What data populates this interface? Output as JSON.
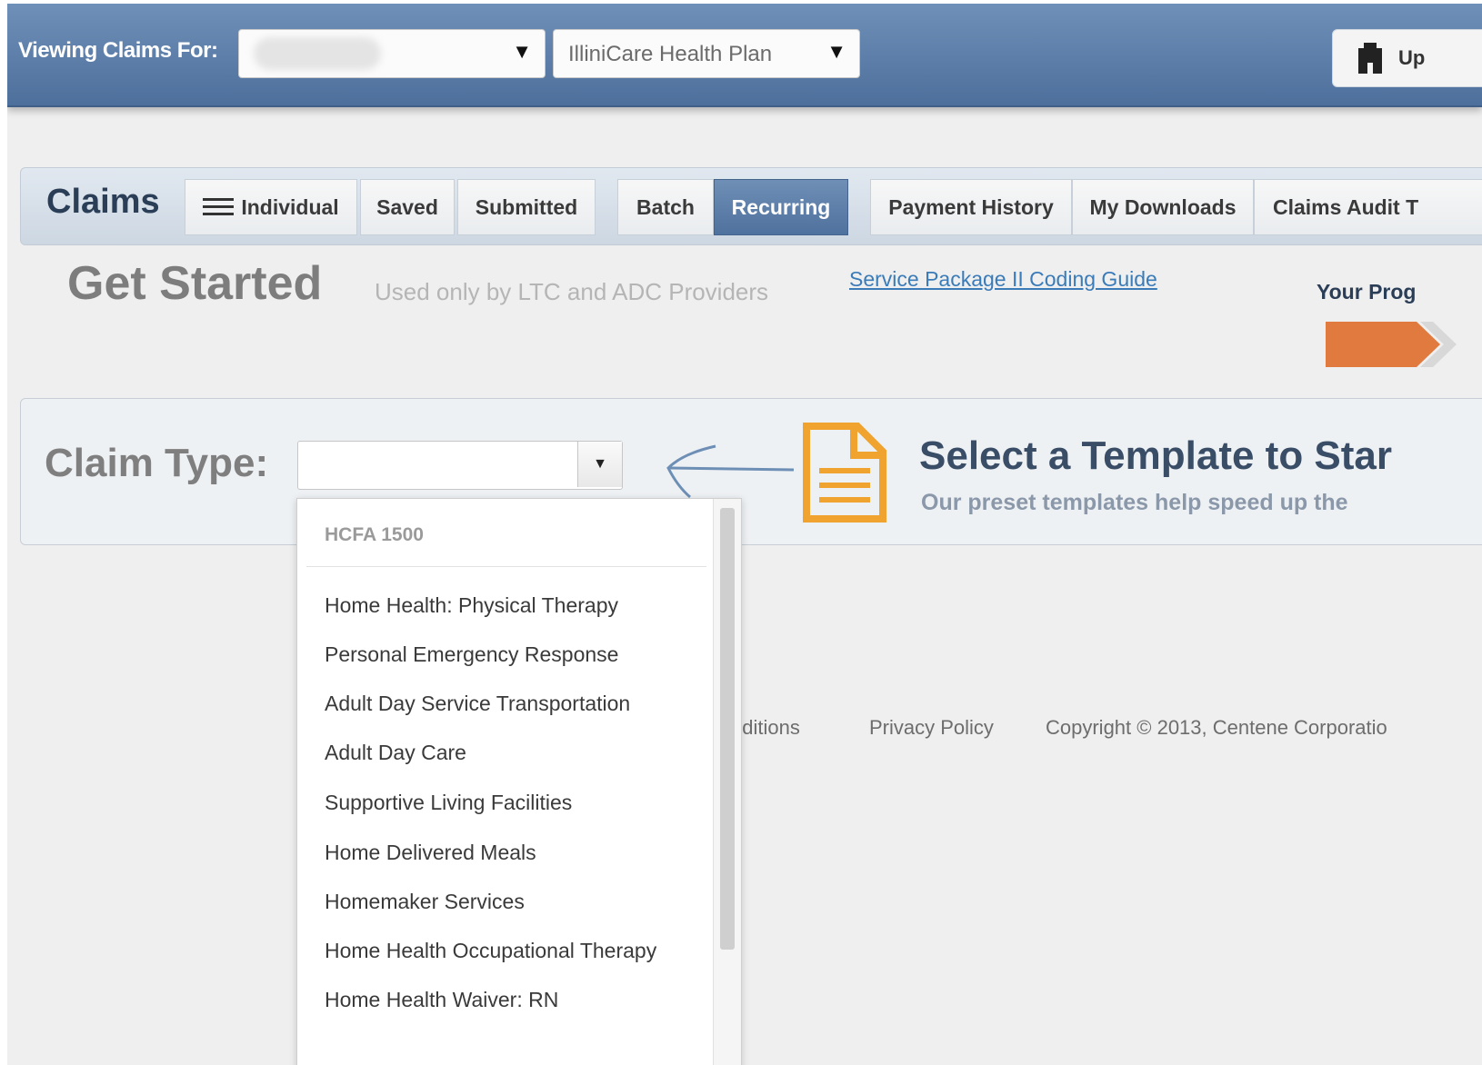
{
  "topbar": {
    "viewing_label": "Viewing Claims For:",
    "plan_value": "IlliniCare Health Plan",
    "update_label": "Up"
  },
  "tabs": {
    "title": "Claims",
    "items": [
      {
        "label": "Individual"
      },
      {
        "label": "Saved"
      },
      {
        "label": "Submitted"
      },
      {
        "label": "Batch"
      },
      {
        "label": "Recurring"
      },
      {
        "label": "Payment History"
      },
      {
        "label": "My Downloads"
      },
      {
        "label": "Claims Audit T"
      }
    ]
  },
  "header": {
    "title": "Get Started",
    "subtitle": "Used only by LTC and ADC Providers",
    "guide_link": "Service Package II Coding Guide",
    "progress_label": "Your Prog"
  },
  "claim": {
    "label": "Claim Type:",
    "template_title": "Select a Template to Star",
    "template_sub": "Our preset templates help speed up the"
  },
  "dropdown": {
    "header": "HCFA 1500",
    "items": [
      "Home Health: Physical Therapy",
      "Personal Emergency Response",
      "Adult Day Service Transportation",
      "Adult Day Care",
      "Supportive Living Facilities",
      "Home Delivered Meals",
      "Homemaker Services",
      "Home Health Occupational Therapy",
      "Home Health Waiver: RN"
    ]
  },
  "footer": {
    "conditions": "nditions",
    "privacy": "Privacy Policy",
    "copyright": "Copyright © 2013, Centene Corporatio"
  },
  "colors": {
    "topbar": "#5a7ba6",
    "active_tab": "#5b7ca8",
    "accent_orange": "#e07a3f",
    "doc_icon": "#f0a32e",
    "link": "#3a7bb8"
  }
}
